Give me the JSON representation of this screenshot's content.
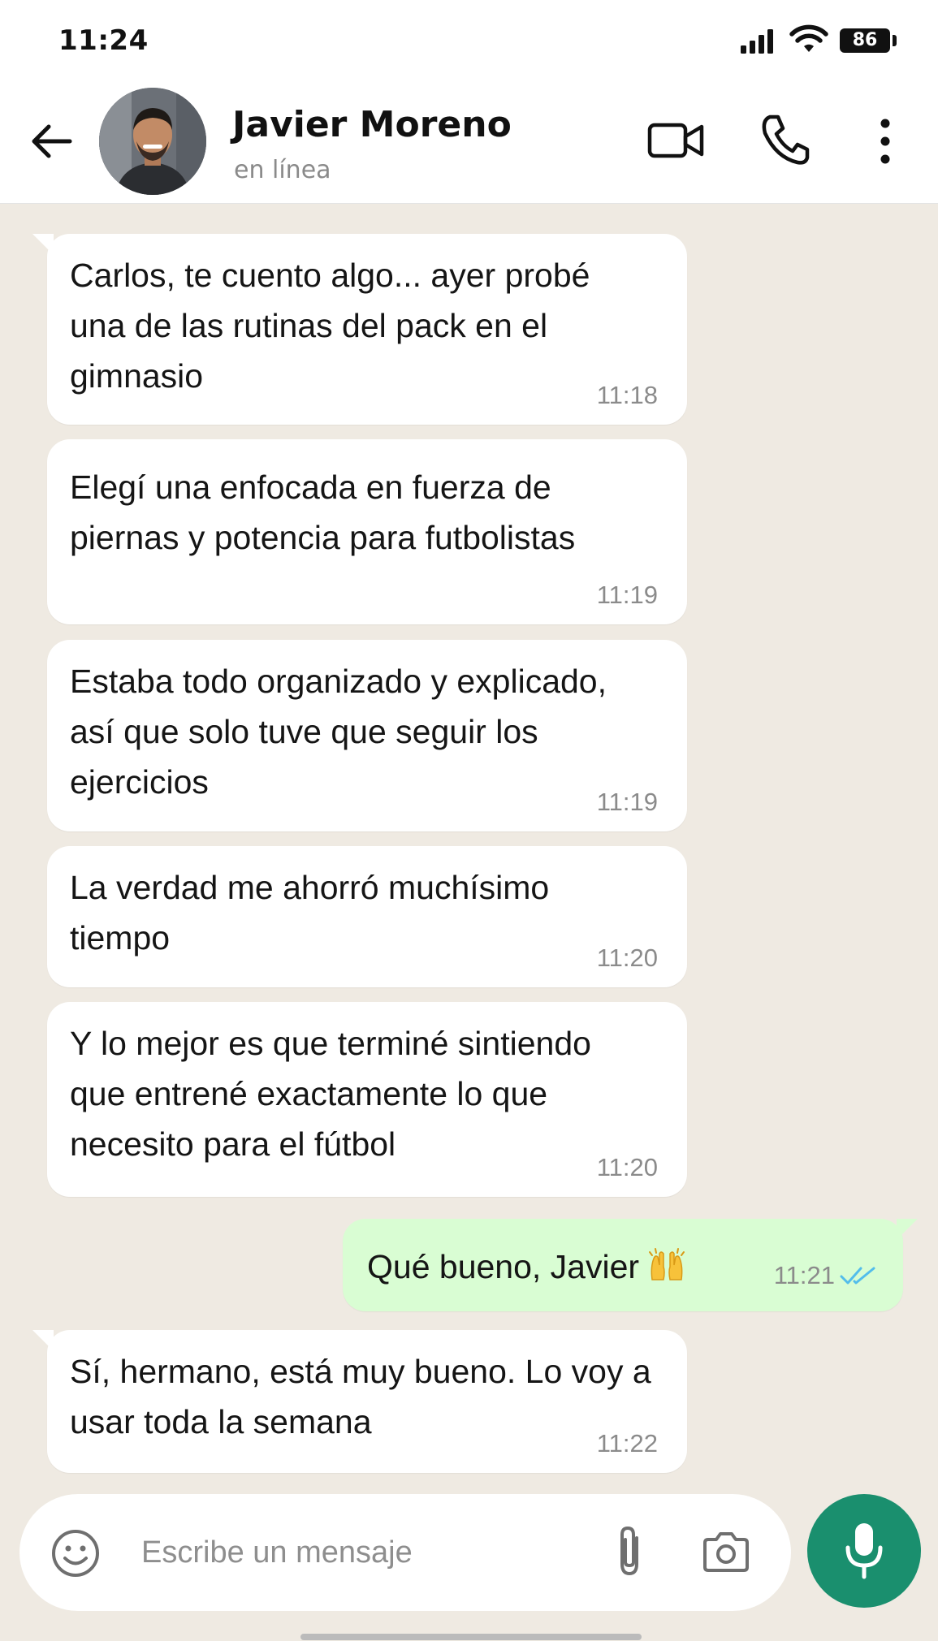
{
  "status_bar": {
    "time": "11:24",
    "battery": "86",
    "icons": [
      "signal-icon",
      "wifi-icon",
      "battery-icon"
    ]
  },
  "header": {
    "contact_name": "Javier Moreno",
    "contact_status": "en línea",
    "icons": [
      "back-arrow-icon",
      "video-call-icon",
      "phone-icon",
      "more-options-icon"
    ]
  },
  "messages": [
    {
      "direction": "in",
      "text": "Carlos, te cuento algo... ayer probé una de las rutinas del pack en el gimnasio",
      "time": "11:18"
    },
    {
      "direction": "in",
      "text": "Elegí una enfocada en fuerza de piernas y potencia para futbolistas",
      "time": "11:19"
    },
    {
      "direction": "in",
      "text": "Estaba todo organizado y explicado, así que solo tuve que seguir los ejercicios",
      "time": "11:19"
    },
    {
      "direction": "in",
      "text": "La verdad me ahorró muchísimo tiempo",
      "time": "11:20"
    },
    {
      "direction": "in",
      "text": "Y lo mejor es que terminé sintiendo que entrené exactamente lo que necesito para el fútbol",
      "time": "11:20"
    },
    {
      "direction": "out",
      "text": "Qué bueno, Javier",
      "emoji": "raising-hands-emoji",
      "time": "11:21",
      "status": "read"
    },
    {
      "direction": "in",
      "text": "Sí, hermano, está muy bueno. Lo voy a usar toda la semana",
      "time": "11:22"
    }
  ],
  "composer": {
    "placeholder": "Escribe un mensaje",
    "value": "",
    "icons": [
      "emoji-icon",
      "attach-icon",
      "camera-icon",
      "microphone-icon"
    ]
  },
  "colors": {
    "chat_background": "#efeae2",
    "incoming_bubble": "#ffffff",
    "outgoing_bubble": "#d9fdd3",
    "mic_button": "#1a8f6e",
    "read_ticks": "#53bdeb"
  }
}
